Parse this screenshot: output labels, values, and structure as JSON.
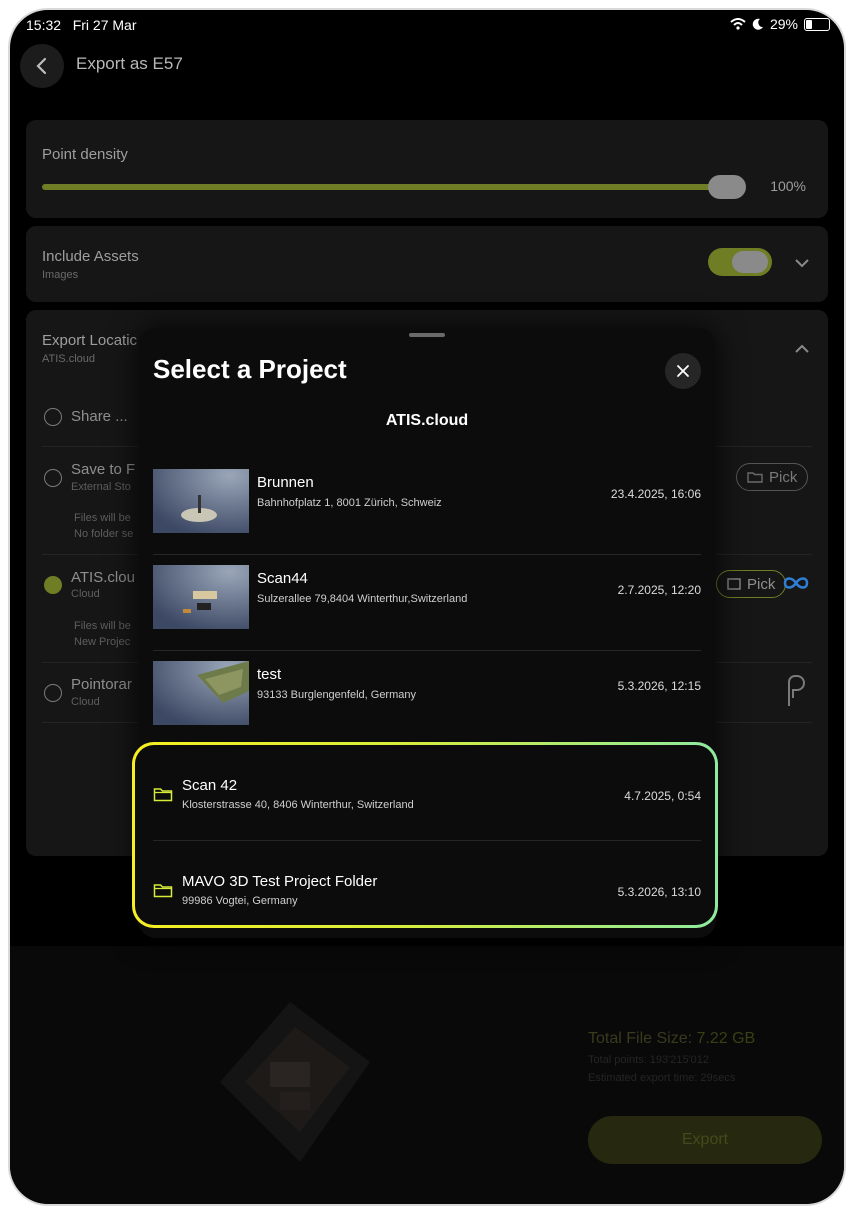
{
  "status": {
    "time": "15:32",
    "date": "Fri 27 Mar",
    "battery": "29%"
  },
  "header": {
    "title": "Export as E57"
  },
  "density": {
    "label": "Point density",
    "value_text": "100%",
    "value": 1.0
  },
  "assets": {
    "label": "Include Assets",
    "sub": "Images",
    "enabled": true
  },
  "location": {
    "label": "Export Locatic",
    "sub": "ATIS.cloud",
    "options": [
      {
        "label": "Share ..."
      },
      {
        "label": "Save to F",
        "sub": "External Sto",
        "note1": "Files will be",
        "note2": "No folder se",
        "pick": "Pick"
      },
      {
        "label": "ATIS.clou",
        "sub": "Cloud",
        "note1": "Files will be",
        "note2": "New Projec",
        "pick": "Pick",
        "selected": true
      },
      {
        "label": "Pointorar",
        "sub": "Cloud"
      }
    ]
  },
  "summary": {
    "total_label": "Total File Size:",
    "total_value": "7.22 GB",
    "points": "Total points: 193'215'012",
    "time": "Estimated export time: 29secs",
    "export": "Export"
  },
  "modal": {
    "title": "Select a Project",
    "subtitle": "ATIS.cloud",
    "projects": [
      {
        "name": "Brunnen",
        "address": "Bahnhofplatz 1, 8001 Zürich, Schweiz",
        "date": "23.4.2025, 16:06"
      },
      {
        "name": "Scan44",
        "address": "Sulzerallee 79,8404 Winterthur,Switzerland",
        "date": "2.7.2025, 12:20"
      },
      {
        "name": "test",
        "address": "93133 Burglengenfeld, Germany",
        "date": "5.3.2026, 12:15"
      }
    ],
    "folders": [
      {
        "name": "Scan 42",
        "address": "Klosterstrasse 40, 8406 Winterthur, Switzerland",
        "date": "4.7.2025, 0:54"
      },
      {
        "name": "MAVO 3D Test Project Folder",
        "address": "99986 Vogtei, Germany",
        "date": "5.3.2026, 13:10"
      }
    ]
  }
}
